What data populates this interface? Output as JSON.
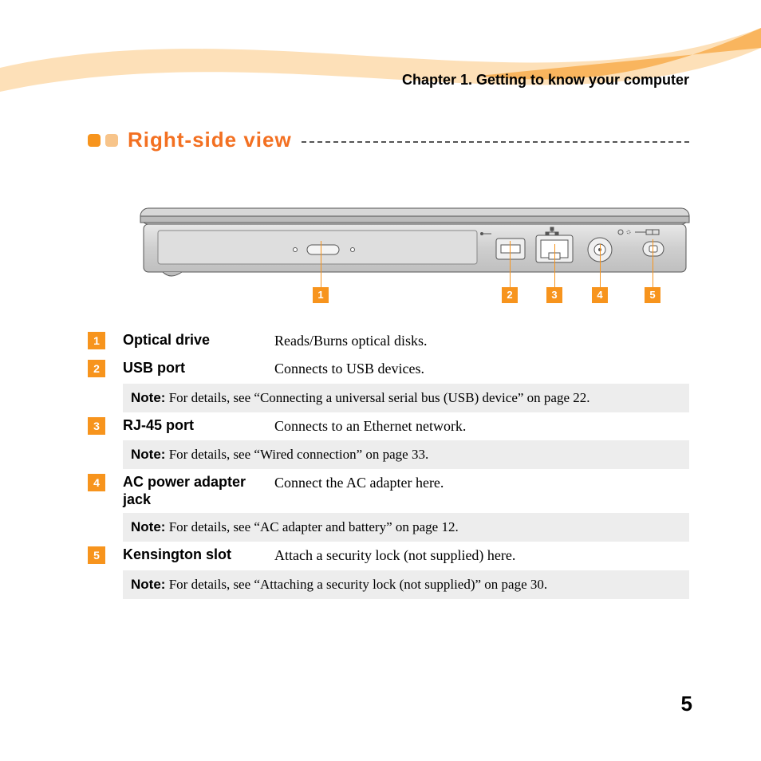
{
  "chapter_header": "Chapter 1. Getting to know your computer",
  "section_title": "Right-side view",
  "callouts": [
    "1",
    "2",
    "3",
    "4",
    "5"
  ],
  "items": [
    {
      "num": "1",
      "term": "Optical drive",
      "desc": "Reads/Burns optical disks.",
      "note": null
    },
    {
      "num": "2",
      "term": "USB port",
      "desc": "Connects to USB devices.",
      "note": "For details, see “Connecting a universal serial bus (USB) device” on page 22."
    },
    {
      "num": "3",
      "term": "RJ-45 port",
      "desc": "Connects to an Ethernet network.",
      "note": "For details, see “Wired connection” on page 33."
    },
    {
      "num": "4",
      "term": "AC power adapter jack",
      "desc": "Connect the AC adapter here.",
      "note": "For details, see “AC adapter and battery” on page 12."
    },
    {
      "num": "5",
      "term": "Kensington slot",
      "desc": "Attach a security lock (not supplied) here.",
      "note": "For details, see “Attaching a security lock (not supplied)” on page 30."
    }
  ],
  "note_label": "Note:",
  "page_number": "5"
}
